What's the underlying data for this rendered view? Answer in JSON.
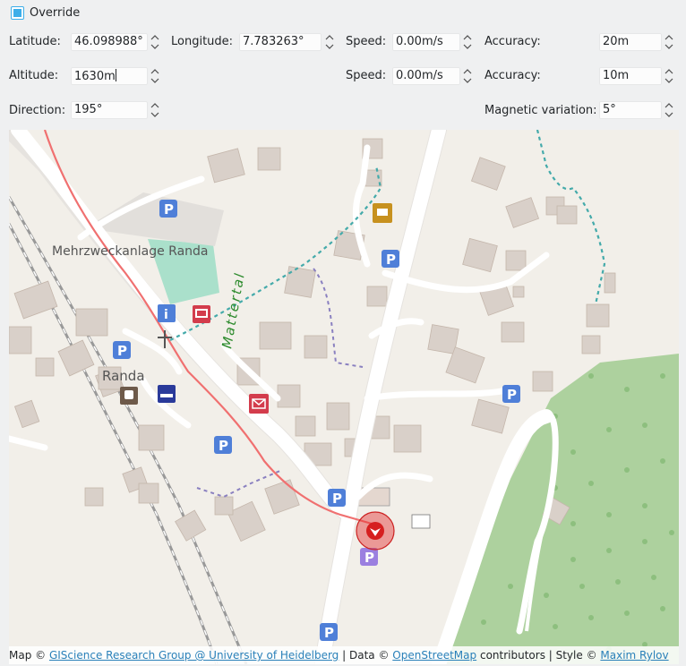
{
  "override": {
    "label": "Override",
    "checked": true
  },
  "row1": {
    "latitude_label": "Latitude:",
    "latitude_value": "46.098988°",
    "longitude_label": "Longitude:",
    "longitude_value": "7.783263°",
    "speed_label": "Speed:",
    "speed_value": "0.00m/s",
    "accuracy_label": "Accuracy:",
    "accuracy_value": "20m"
  },
  "row2": {
    "altitude_label": "Altitude:",
    "altitude_value": "1630m",
    "speed_label": "Speed:",
    "speed_value": "0.00m/s",
    "accuracy_label": "Accuracy:",
    "accuracy_value": "10m"
  },
  "row3": {
    "direction_label": "Direction:",
    "direction_value": "195°",
    "magnetic_label": "Magnetic variation:",
    "magnetic_value": "5°"
  },
  "map": {
    "place_labels": [
      "Mehrzweckanlage Randa",
      "Mattertal",
      "Randa"
    ],
    "attribution": {
      "map_prefix": "Map ©",
      "map_link": "GIScience Research Group @ University of Heidelberg",
      "data_prefix": "| Data ©",
      "data_link": "OpenStreetMap",
      "style_prefix": "contributors | Style ©",
      "style_link": "Maxim Rylov"
    },
    "colors": {
      "forest": "#add19e",
      "road": "#ffffff",
      "building": "#d9d0c9",
      "track": "#f06a6a",
      "marker": "#e23030",
      "parking": "#4f7fd8"
    }
  }
}
